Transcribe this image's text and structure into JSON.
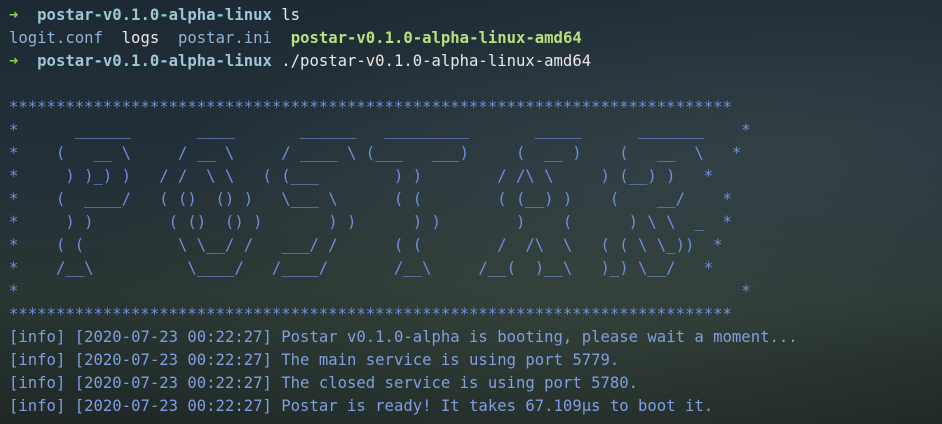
{
  "prompt": {
    "arrow": "➜",
    "dir": "postar-v0.1.0-alpha-linux"
  },
  "line1": {
    "command": "ls"
  },
  "ls_output": [
    "logit.conf",
    "logs",
    "postar.ini",
    "postar-v0.1.0-alpha-linux-amd64"
  ],
  "line3": {
    "command": "./postar-v0.1.0-alpha-linux-amd64"
  },
  "banner": [
    "*****************************************************************************",
    "*      ______       ____       ______   _________       _____      _______    *",
    "*    (   __ \\     / __ \\     / ____ \\ (___   ___)     (  __ )    (   __  \\   *",
    "*     ) )_) )   / /  \\ \\   ( (___        ) )        / /\\ \\     ) (__) )   *",
    "*    (  ____/   ( ()  () )   \\___ \\      ( (        ( (__) )    (    __/    *",
    "*     ) )        ( ()  () )       ) )      ) )        )    (      ) \\ \\  _  *",
    "*    ( (          \\ \\__/ /   ___/ /      ( (        /  /\\  \\   ( ( \\ \\_))  *",
    "*    /__\\          \\____/   /____/       /__\\     /__(  )__\\   )_) \\__/   *",
    "*                                                                             *",
    "*****************************************************************************"
  ],
  "logs": [
    {
      "level": "[info]",
      "time": "[2020-07-23 00:22:27]",
      "message": "Postar v0.1.0-alpha is booting, please wait a moment..."
    },
    {
      "level": "[info]",
      "time": "[2020-07-23 00:22:27]",
      "message": "The main service is using port 5779."
    },
    {
      "level": "[info]",
      "time": "[2020-07-23 00:22:27]",
      "message": "The closed service is using port 5780."
    },
    {
      "level": "[info]",
      "time": "[2020-07-23 00:22:27]",
      "message": "Postar is ready! It takes 67.109µs to boot it."
    }
  ],
  "colors": {
    "arrow": "#8bd15a",
    "directory": "#9bc7d6",
    "file": "#8fb4d8",
    "executable": "#b7e07e",
    "banner": "#6f8fdc",
    "log": "#7f9fe2"
  }
}
